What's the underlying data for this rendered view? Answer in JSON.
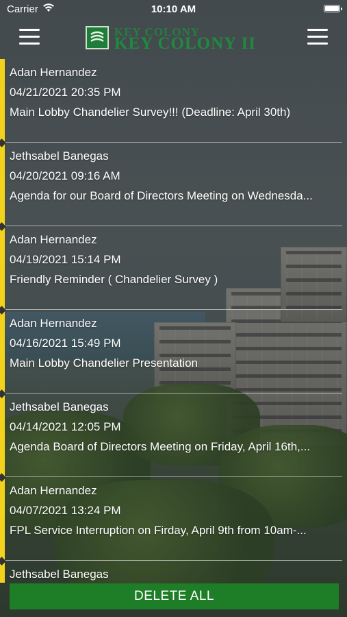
{
  "status_bar": {
    "carrier": "Carrier",
    "time": "10:10 AM",
    "wifi_icon": "wifi-icon",
    "battery_icon": "battery-icon"
  },
  "header": {
    "logo_line1": "KEY COLONY",
    "logo_line2": "KEY COLONY II",
    "left_menu_icon": "hamburger-menu-icon",
    "right_menu_icon": "hamburger-menu-icon",
    "brand_color": "#1f8a3d",
    "accent_color": "#f2d21a"
  },
  "messages": [
    {
      "sender": "Adan Hernandez",
      "date": "04/21/2021 20:35 PM",
      "subject": "Main Lobby Chandelier Survey!!! (Deadline: April 30th)"
    },
    {
      "sender": "Jethsabel Banegas",
      "date": "04/20/2021 09:16 AM",
      "subject": "Agenda for our Board of Directors Meeting on Wednesda..."
    },
    {
      "sender": "Adan Hernandez",
      "date": "04/19/2021 15:14 PM",
      "subject": "Friendly Reminder ( Chandelier Survey )"
    },
    {
      "sender": "Adan Hernandez",
      "date": "04/16/2021 15:49 PM",
      "subject": "Main Lobby Chandelier Presentation"
    },
    {
      "sender": "Jethsabel Banegas",
      "date": "04/14/2021 12:05 PM",
      "subject": "Agenda Board of Directors Meeting on Friday, April 16th,..."
    },
    {
      "sender": "Adan Hernandez",
      "date": "04/07/2021 13:24 PM",
      "subject": "FPL Service Interruption on Firday, April 9th from 10am-..."
    },
    {
      "sender": "Jethsabel Banegas",
      "date": "",
      "subject": ""
    }
  ],
  "footer": {
    "delete_all_label": "DELETE ALL",
    "button_color": "#1e7e27"
  }
}
